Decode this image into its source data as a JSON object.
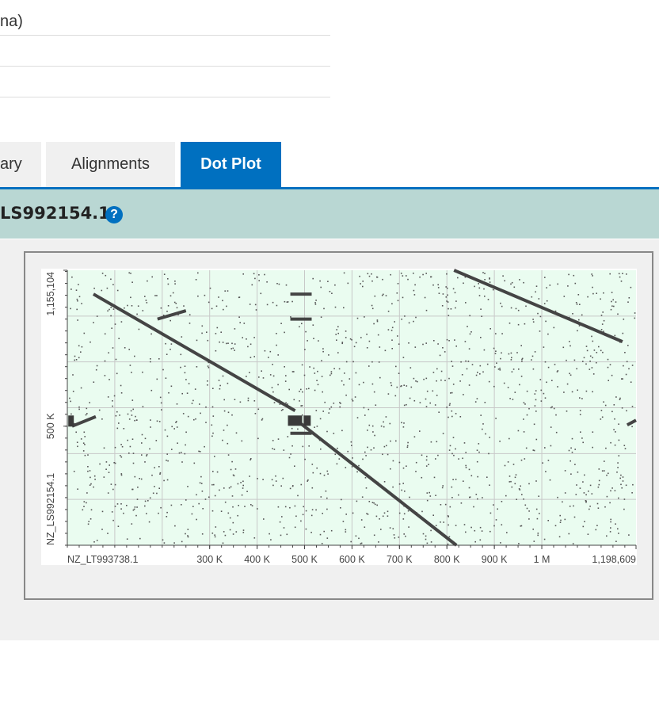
{
  "summary_rows": [
    "na)",
    "",
    ""
  ],
  "tabs": [
    {
      "label": "ary",
      "active": false
    },
    {
      "label": "Alignments",
      "active": false
    },
    {
      "label": "Dot Plot",
      "active": true
    }
  ],
  "section": {
    "title": "LS992154.1",
    "help_icon": "question-circle-icon"
  },
  "colors": {
    "accent": "#0070c0",
    "header_bg": "#b9d7d3",
    "plot_bg": "#eafcf0",
    "dots": "#444444"
  },
  "chart_data": {
    "type": "scatter",
    "subtype": "dot-plot",
    "x_sequence": "NZ_LT993738.1",
    "y_sequence": "NZ_LS992154.1",
    "x_tick_labels": [
      "300 K",
      "400 K",
      "500 K",
      "600 K",
      "700 K",
      "800 K",
      "900 K",
      "1 M",
      "1,198,609"
    ],
    "x_ticks": [
      300000,
      400000,
      500000,
      600000,
      700000,
      800000,
      900000,
      1000000,
      1198609
    ],
    "y_tick_labels": [
      "500 K",
      "1,155,104"
    ],
    "y_ticks": [
      500000,
      1155104
    ],
    "xlim": [
      0,
      1198609
    ],
    "ylim": [
      0,
      1155104
    ],
    "grid": true,
    "alignments": [
      {
        "x": [
          55000,
          480000
        ],
        "y": [
          1055000,
          565000
        ]
      },
      {
        "x": [
          480000,
          820000
        ],
        "y": [
          530000,
          0
        ]
      },
      {
        "x": [
          815000,
          1170000
        ],
        "y": [
          1155104,
          855000
        ]
      },
      {
        "x": [
          10000,
          60000
        ],
        "y": [
          500000,
          540000
        ]
      },
      {
        "x": [
          190000,
          250000
        ],
        "y": [
          950000,
          985000
        ]
      },
      {
        "x": [
          470000,
          515000
        ],
        "y": [
          950000,
          950000
        ]
      },
      {
        "x": [
          470000,
          515000
        ],
        "y": [
          1055000,
          1055000
        ]
      },
      {
        "x": [
          470000,
          515000
        ],
        "y": [
          470000,
          470000
        ]
      },
      {
        "x": [
          1180000,
          1198609
        ],
        "y": [
          505000,
          525000
        ]
      }
    ]
  }
}
